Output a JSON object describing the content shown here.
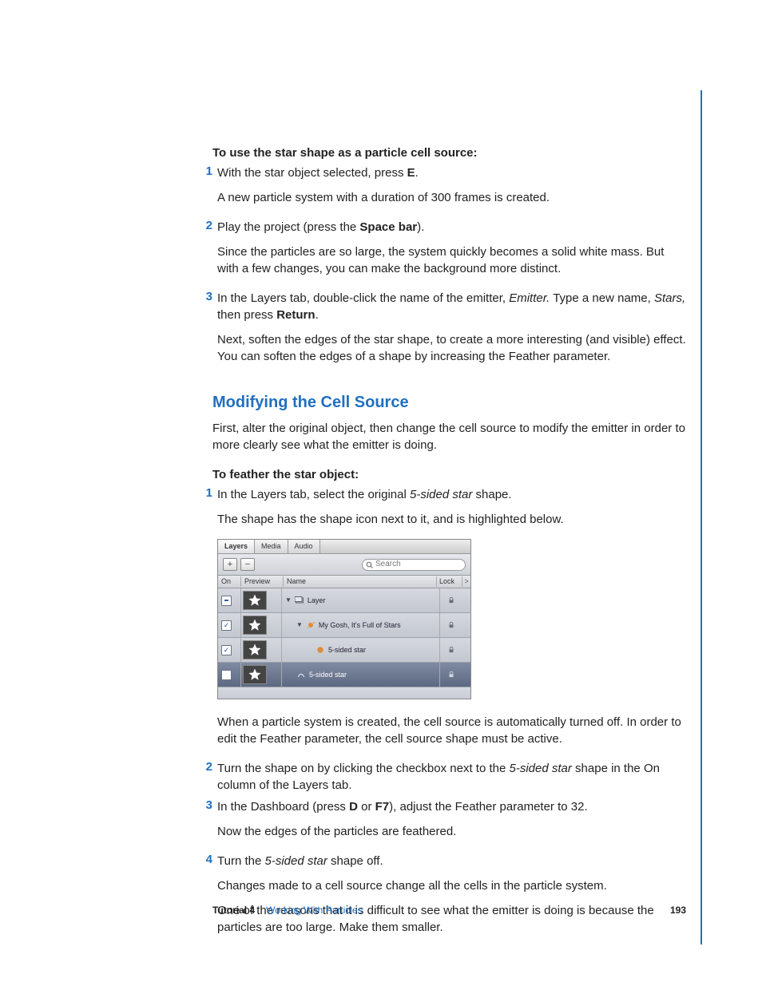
{
  "headings": {
    "use_star": "To use the star shape as a particle cell source:",
    "modifying": "Modifying the Cell Source",
    "feather": "To feather the star object:"
  },
  "steps_a": {
    "s1a": "With the star object selected, press ",
    "s1b": "E",
    "s1c": ".",
    "s1_sub": "A new particle system with a duration of 300 frames is created.",
    "s2a": "Play the project (press the ",
    "s2b": "Space bar",
    "s2c": ").",
    "s2_sub": "Since the particles are so large, the system quickly becomes a solid white mass. But with a few changes, you can make the background more distinct.",
    "s3a": "In the Layers tab, double-click the name of the emitter, ",
    "s3b": "Emitter.",
    "s3c": " Type a new name, ",
    "s3d": "Stars,",
    "s3e": " then press ",
    "s3f": "Return",
    "s3g": ".",
    "s3_sub": "Next, soften the edges of the star shape, to create a more interesting (and visible) effect. You can soften the edges of a shape by increasing the Feather parameter."
  },
  "mod_intro": "First, alter the original object, then change the cell source to modify the emitter in order to more clearly see what the emitter is doing.",
  "steps_b": {
    "s1a": "In the Layers tab, select the original ",
    "s1b": "5-sided star",
    "s1c": " shape.",
    "s1_sub": "The shape has the shape icon next to it, and is highlighted below.",
    "after_img": "When a particle system is created, the cell source is automatically turned off. In order to edit the Feather parameter, the cell source shape must be active.",
    "s2a": "Turn the shape on by clicking the checkbox next to the ",
    "s2b": "5-sided star",
    "s2c": " shape in the On column of the Layers tab.",
    "s3a": "In the Dashboard (press ",
    "s3b": "D",
    "s3c": " or ",
    "s3d": "F7",
    "s3e": "), adjust the Feather parameter to 32.",
    "s3_sub": "Now the edges of the particles are feathered.",
    "s4a": "Turn the ",
    "s4b": "5-sided star",
    "s4c": " shape off.",
    "s4_sub1": "Changes made to a cell source change all the cells in the particle system.",
    "s4_sub2": "One of the reasons that it is difficult to see what the emitter is doing is because the particles are too large. Make them smaller."
  },
  "panel": {
    "tabs": {
      "layers": "Layers",
      "media": "Media",
      "audio": "Audio"
    },
    "btn_plus": "+",
    "btn_minus": "−",
    "search_placeholder": "Search",
    "cols": {
      "on": "On",
      "preview": "Preview",
      "name": "Name",
      "lock": "Lock",
      "chev": ">"
    },
    "rows": {
      "r1": "Layer",
      "r2": "My Gosh, It's Full of Stars",
      "r3": "5-sided star",
      "r4": "5-sided star"
    }
  },
  "footer": {
    "tutorial": "Tutorial 4",
    "title": "Working With Particles",
    "page": "193"
  },
  "nums": {
    "n1": "1",
    "n2": "2",
    "n3": "3",
    "n4": "4"
  }
}
